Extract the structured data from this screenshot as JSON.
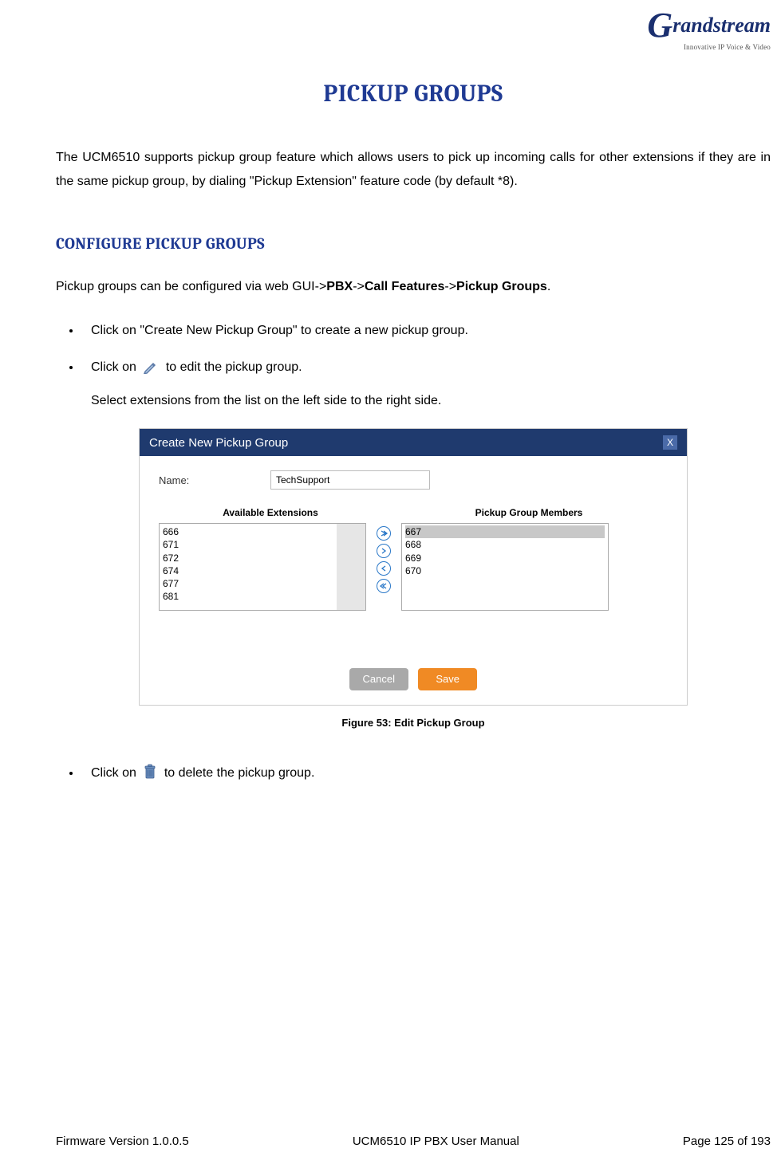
{
  "header": {
    "brand_leading_char": "G",
    "brand_rest": "randstream",
    "tagline": "Innovative IP Voice & Video"
  },
  "title": "PICKUP GROUPS",
  "intro": "The UCM6510 supports pickup group feature which allows users to pick up incoming calls for other extensions if they are in the same pickup group, by dialing \"Pickup Extension\" feature code (by default *8).",
  "section_heading": "CONFIGURE PICKUP GROUPS",
  "config_sentence_pre": "Pickup groups can be configured via web GUI->",
  "config_path": {
    "p1": "PBX",
    "p2": "Call Features",
    "p3": "Pickup Groups"
  },
  "bullets": {
    "b1": "Click on \"Create New Pickup Group\" to create a new pickup group.",
    "b2_pre": "Click on",
    "b2_post": "to edit the pickup group.",
    "b2_sub": "Select extensions from the list on the left side to the right side.",
    "b3_pre": "Click on",
    "b3_post": "to delete the pickup group."
  },
  "figure": {
    "dialog_title": "Create New Pickup Group",
    "close_label": "X",
    "name_label": "Name:",
    "name_value": "TechSupport",
    "left_header": "Available Extensions",
    "right_header": "Pickup Group Members",
    "available": [
      "666",
      "671",
      "672",
      "674",
      "677",
      "681"
    ],
    "members": [
      "667",
      "668",
      "669",
      "670"
    ],
    "cancel_label": "Cancel",
    "save_label": "Save",
    "caption": "Figure 53: Edit Pickup Group"
  },
  "footer": {
    "left": "Firmware Version 1.0.0.5",
    "center": "UCM6510 IP PBX User Manual",
    "right": "Page 125 of 193"
  }
}
